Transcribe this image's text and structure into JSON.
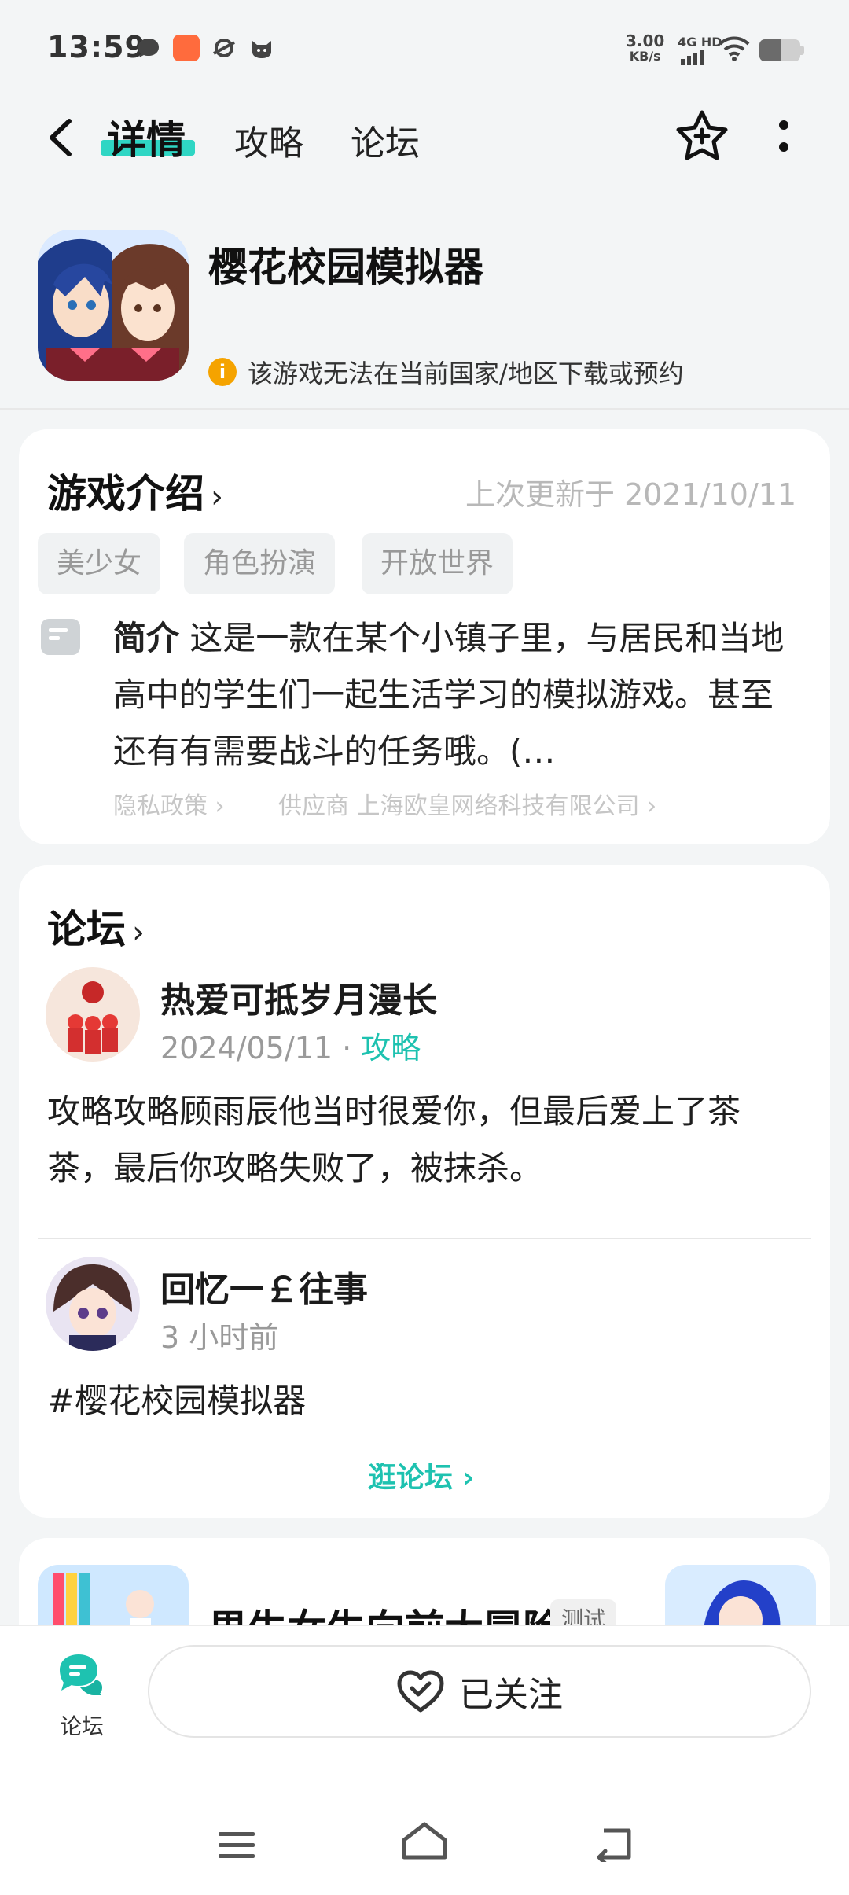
{
  "status": {
    "time": "13:59",
    "netspeed_value": "3.00",
    "netspeed_unit": "KB/s",
    "network": "4G HD"
  },
  "header": {
    "tabs": [
      {
        "label": "详情",
        "active": true
      },
      {
        "label": "攻略",
        "active": false
      },
      {
        "label": "论坛",
        "active": false
      }
    ],
    "icons": [
      "back-icon",
      "star-plus-icon",
      "more-icon"
    ]
  },
  "app": {
    "title": "樱花校园模拟器",
    "warning": "该游戏无法在当前国家/地区下载或预约"
  },
  "intro": {
    "title": "游戏介绍",
    "updated": "上次更新于 2021/10/11",
    "tags": [
      "美少女",
      "角色扮演",
      "开放世界"
    ],
    "summary_label": "简介",
    "summary": "这是一款在某个小镇子里，与居民和当地高中的学生们一起生活学习的模拟游戏。甚至还有有需要战斗的任务哦。(…",
    "privacy": "隐私政策",
    "supplier": "供应商 上海欧皇网络科技有限公司"
  },
  "forum": {
    "title": "论坛",
    "posts": [
      {
        "author": "热爱可抵岁月漫长",
        "date": "2024/05/11",
        "category": "攻略",
        "text": "攻略攻略顾雨辰他当时很爱你，但最后爱上了茶茶，最后你攻略失败了，被抹杀。"
      },
      {
        "author": "回忆一￡往事",
        "date": "3 小时前",
        "text": "#樱花校园模拟器"
      }
    ],
    "more_label": "逛论坛"
  },
  "next": {
    "title": "男生女生向前大冒险",
    "badge": "测试"
  },
  "bottom": {
    "forum_label": "论坛",
    "follow_label": "已关注"
  },
  "colors": {
    "accent": "#1ec2b0",
    "warning": "#f5a300",
    "background": "#f3f5f6"
  }
}
